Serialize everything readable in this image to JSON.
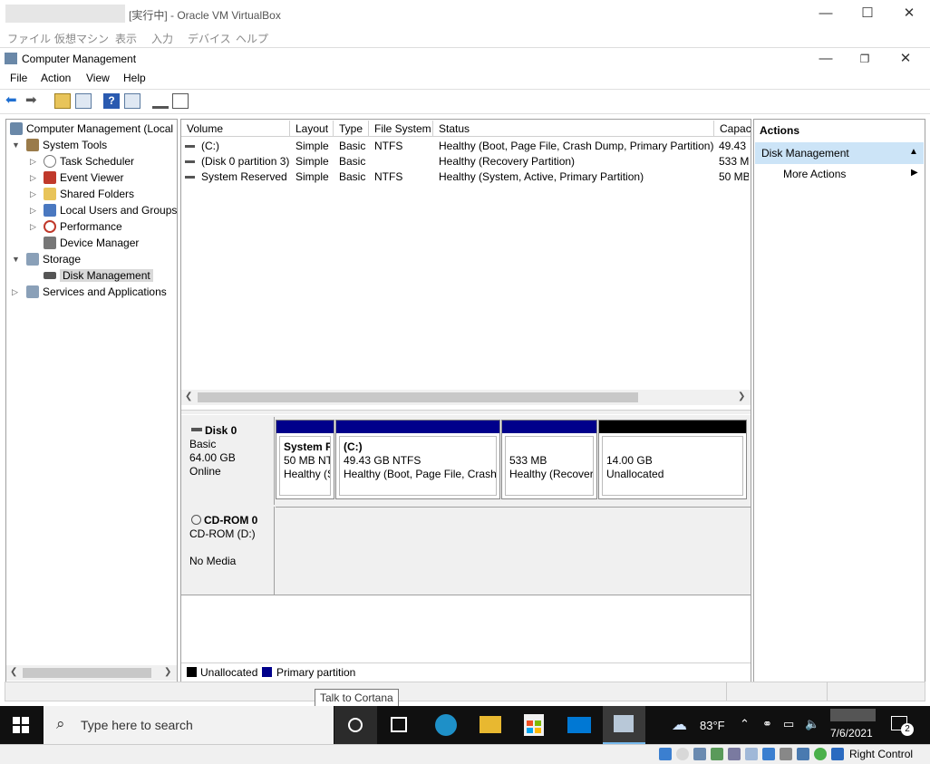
{
  "vbox": {
    "title": "[実行中] - Oracle VM VirtualBox",
    "menu": [
      "ファイル",
      "仮想マシン",
      "表示",
      "入力",
      "デバイス",
      "ヘルプ"
    ]
  },
  "window": {
    "title": "Computer Management",
    "menu": [
      "File",
      "Action",
      "View",
      "Help"
    ]
  },
  "tree": {
    "root": "Computer Management (Local",
    "items": [
      {
        "label": "System Tools"
      },
      {
        "label": "Task Scheduler"
      },
      {
        "label": "Event Viewer"
      },
      {
        "label": "Shared Folders"
      },
      {
        "label": "Local Users and Groups"
      },
      {
        "label": "Performance"
      },
      {
        "label": "Device Manager"
      },
      {
        "label": "Storage"
      },
      {
        "label": "Disk Management"
      },
      {
        "label": "Services and Applications"
      }
    ]
  },
  "volumes": {
    "columns": [
      "Volume",
      "Layout",
      "Type",
      "File System",
      "Status",
      "Capac"
    ],
    "rows": [
      {
        "volume": "(C:)",
        "layout": "Simple",
        "type": "Basic",
        "fs": "NTFS",
        "status": "Healthy (Boot, Page File, Crash Dump, Primary Partition)",
        "capacity": "49.43 G"
      },
      {
        "volume": "(Disk 0 partition 3)",
        "layout": "Simple",
        "type": "Basic",
        "fs": "",
        "status": "Healthy (Recovery Partition)",
        "capacity": "533 M"
      },
      {
        "volume": "System Reserved",
        "layout": "Simple",
        "type": "Basic",
        "fs": "NTFS",
        "status": "Healthy (System, Active, Primary Partition)",
        "capacity": "50 MB"
      }
    ]
  },
  "disks": {
    "disk0": {
      "name": "Disk 0",
      "type": "Basic",
      "size": "64.00 GB",
      "state": "Online"
    },
    "cdrom0": {
      "name": "CD-ROM 0",
      "drive": "CD-ROM (D:)",
      "media": "No Media"
    },
    "partitions": [
      {
        "title": "System R",
        "line1": "50 MB NT",
        "line2": "Healthy (S"
      },
      {
        "title": "(C:)",
        "line1": "49.43 GB NTFS",
        "line2": "Healthy (Boot, Page File, Crash D"
      },
      {
        "title": "",
        "line1": "533 MB",
        "line2": "Healthy (Recover"
      },
      {
        "title": "",
        "line1": "14.00 GB",
        "line2": "Unallocated"
      }
    ],
    "legend": {
      "unallocated": "Unallocated",
      "primary": "Primary partition"
    }
  },
  "actions": {
    "header": "Actions",
    "section": "Disk Management",
    "more": "More Actions"
  },
  "tooltip": "Talk to Cortana",
  "taskbar": {
    "search_placeholder": "Type here to search",
    "weather": "83°F",
    "date": "7/6/2021",
    "notifications": "2"
  },
  "vbox_status": {
    "host_key": "Right Control"
  },
  "colors": {
    "primary": "#00008b",
    "unallocated": "#000000",
    "selection": "#cce4f7"
  }
}
